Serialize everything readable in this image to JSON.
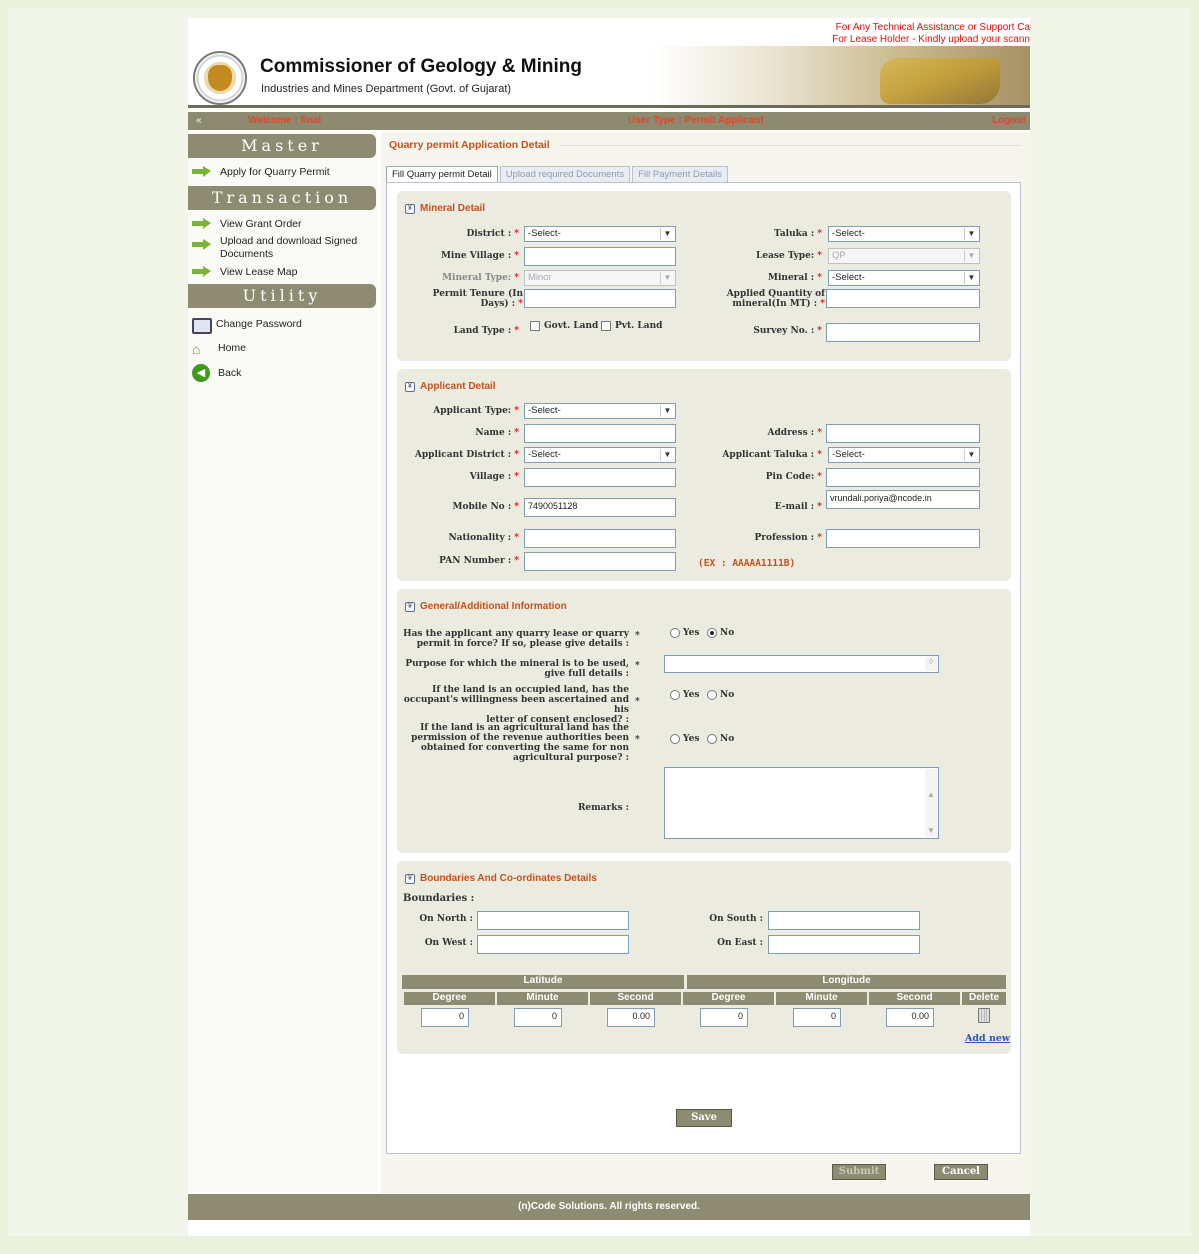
{
  "header": {
    "notice_line1": "For Any Technical Assistance or Support Ca",
    "notice_line2": "For Lease Holder - Kindly upload your scann",
    "title": "Commissioner of Geology & Mining",
    "subtitle": "Industries and Mines Department (Govt. of Gujarat)"
  },
  "topbar": {
    "collapse": "«",
    "welcome": "Welcome : final",
    "user_type": "User Type : Permit Applicant",
    "logout": "Logout"
  },
  "sidebar": {
    "master": "Master",
    "master_items": [
      {
        "label": "Apply for Quarry Permit"
      }
    ],
    "transaction": "Transaction",
    "transaction_items": [
      {
        "label": "View Grant Order"
      },
      {
        "label": "Upload and download Signed Documents"
      },
      {
        "label": "View Lease Map"
      }
    ],
    "utility": "Utility",
    "utility_items": [
      {
        "label": "Change Password"
      },
      {
        "label": "Home"
      },
      {
        "label": "Back"
      }
    ]
  },
  "main": {
    "page_title": "Quarry permit Application Detail",
    "tabs": [
      {
        "label": "Fill Quarry permit Detail"
      },
      {
        "label": "Upload required Documents"
      },
      {
        "label": "Fill Payment Details"
      }
    ]
  },
  "mineral": {
    "heading": "Mineral Detail",
    "district_label": "District :",
    "district_value": "-Select-",
    "taluka_label": "Taluka :",
    "taluka_value": "-Select-",
    "mine_village_label": "Mine Village :",
    "lease_type_label": "Lease Type:",
    "lease_type_value": "QP",
    "mineral_type_label": "Mineral Type:",
    "mineral_type_value": "Minor",
    "mineral_label": "Mineral :",
    "mineral_value": "-Select-",
    "tenure_label_1": "Permit Tenure (In",
    "tenure_label_2": "Days) :",
    "applied_label_1": "Applied Quantity of",
    "applied_label_2": "mineral(In MT) :",
    "land_type_label": "Land Type :",
    "govt_land": "Govt. Land",
    "pvt_land": "Pvt. Land",
    "survey_label": "Survey No. :"
  },
  "applicant": {
    "heading": "Applicant Detail",
    "type_label": "Applicant Type:",
    "type_value": "-Select-",
    "name_label": "Name :",
    "address_label": "Address :",
    "district_label": "Applicant District :",
    "district_value": "-Select-",
    "taluka_label": "Applicant Taluka :",
    "taluka_value": "-Select-",
    "village_label": "Village :",
    "pin_label": "Pin Code:",
    "mobile_label": "Mobile No :",
    "mobile_value": "7490051128",
    "email_label": "E-mail :",
    "email_value": "vrundali.poriya@ncode.in",
    "nationality_label": "Nationality :",
    "profession_label": "Profession :",
    "pan_label": "PAN Number :",
    "pan_example": "(EX : AAAAA1111B)"
  },
  "general": {
    "heading": "General/Additional Information",
    "q1_l1": "Has the applicant any quarry lease or quarry",
    "q1_l2": "permit in force? If so, please give details :",
    "q2_l1": "Purpose for which the mineral is to be used,",
    "q2_l2": "give full details :",
    "q3_l1": "If the land is an occupied land, has the",
    "q3_l2": "occupant's willingness been ascertained and his",
    "q3_l3": "letter of consent enclosed? :",
    "q4_l1": "If the land is an agricultural land has the",
    "q4_l2": "permission of the revenue authorities been",
    "q4_l3": "obtained for converting the same for non",
    "q4_l4": "agricultural purpose? :",
    "yes": "Yes",
    "no": "No",
    "remarks_label": "Remarks :"
  },
  "boundaries": {
    "heading": "Boundaries And Co-ordinates Details",
    "sub": "Boundaries :",
    "north": "On North :",
    "south": "On South :",
    "west": "On West :",
    "east": "On East :",
    "latitude": "Latitude",
    "longitude": "Longitude",
    "cols": [
      "Degree",
      "Minute",
      "Second",
      "Degree",
      "Minute",
      "Second",
      "Delete"
    ],
    "row": [
      "0",
      "0",
      "0.00",
      "0",
      "0",
      "0.00"
    ],
    "add_new": "Add new"
  },
  "buttons": {
    "save": "Save",
    "submit": "Submit",
    "cancel": "Cancel"
  },
  "footer": {
    "text": "(n)Code Solutions. All rights reserved."
  },
  "colors": {
    "accent": "#c8501a",
    "bar": "#8d8c72",
    "required": "#e01010"
  }
}
